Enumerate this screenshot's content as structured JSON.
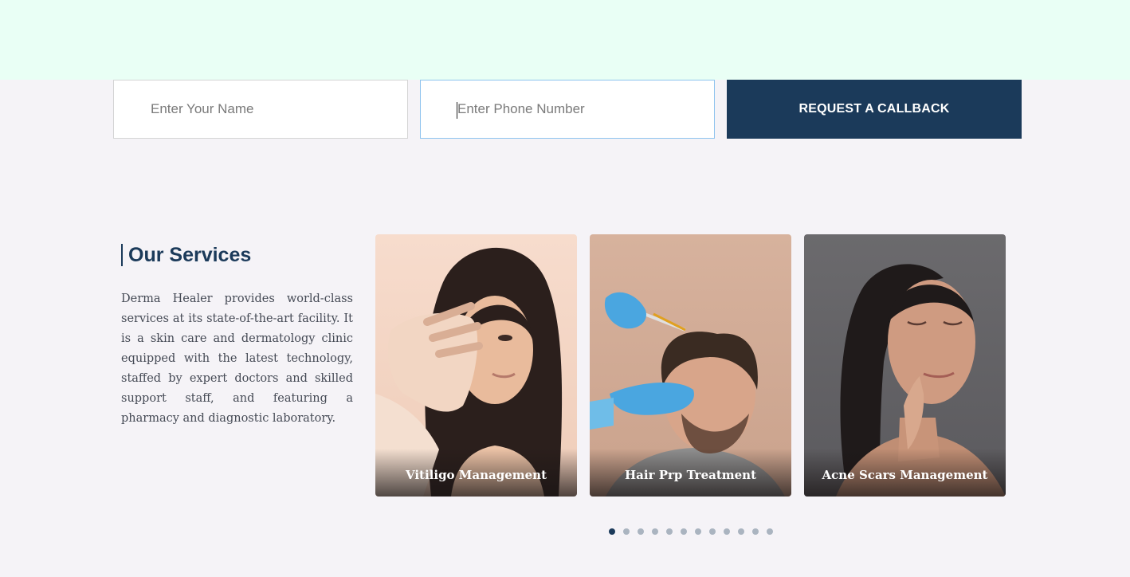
{
  "form": {
    "name_placeholder": "Enter Your Name",
    "phone_placeholder": "Enter Phone Number",
    "submit_label": "REQUEST A CALLBACK"
  },
  "services": {
    "title": "Our Services",
    "description": "Derma Healer provides world-class services at its state-of-the-art facility. It is a skin care and dermatology clinic equipped with the latest technology, staffed by expert doctors and skilled support staff, and featuring a pharmacy and diagnostic laboratory.",
    "cards": [
      {
        "label": "Vitiligo Management"
      },
      {
        "label": "Hair Prp Treatment"
      },
      {
        "label": "Acne Scars Management"
      }
    ]
  },
  "carousel": {
    "total_dots": 12,
    "active_index": 0
  },
  "colors": {
    "top_band": "#e9fff5",
    "page_bg": "#f5f3f7",
    "brand_navy": "#1b3a5a",
    "focus_border": "#8ec3ee",
    "dot_inactive": "#aab4c0"
  }
}
